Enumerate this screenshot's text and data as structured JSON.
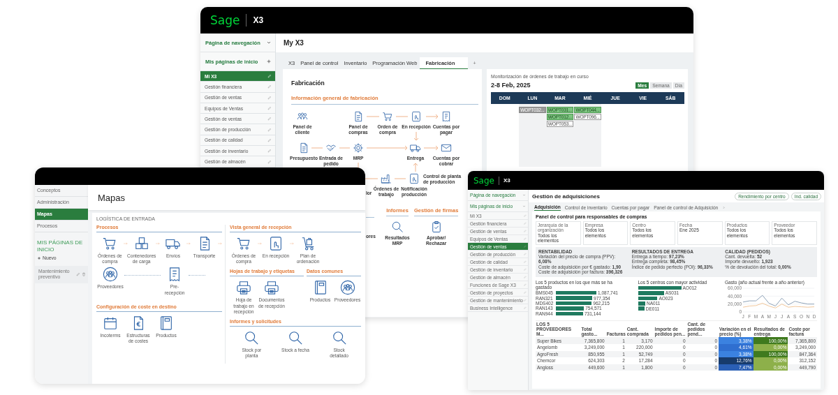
{
  "back_window": {
    "brand": "Sage",
    "product": "X3",
    "nav": {
      "title": "Página de navegación",
      "home_title": "Mis páginas de inicio",
      "items": [
        {
          "label": "Mi X3",
          "selected": true
        },
        {
          "label": "Gestión financiera",
          "selected": false
        },
        {
          "label": "Gestión de ventas",
          "selected": false
        },
        {
          "label": "Equipos de Ventas",
          "selected": false
        },
        {
          "label": "Gestión de ventas",
          "selected": false
        },
        {
          "label": "Gestión de producción",
          "selected": false
        },
        {
          "label": "Gestión de calidad",
          "selected": false
        },
        {
          "label": "Gestión de inventario",
          "selected": false
        },
        {
          "label": "Gestión de almacén",
          "selected": false
        }
      ]
    },
    "page_title": "My X3",
    "tabs": [
      {
        "label": "X3",
        "selected": false
      },
      {
        "label": "Panel de control",
        "selected": false
      },
      {
        "label": "Inventario",
        "selected": false
      },
      {
        "label": "Programación Web",
        "selected": false
      },
      {
        "label": "Fabricación",
        "selected": true
      }
    ],
    "add_tab": "+",
    "manufacturing_panel": {
      "title": "Fabricación",
      "section": "Información general de fabricación",
      "nodes": [
        {
          "label": "Panel de cliente"
        },
        {
          "label": "Panel de compras"
        },
        {
          "label": "Orden de compra"
        },
        {
          "label": "En recepción"
        },
        {
          "label": "Cuentas por pagar"
        },
        {
          "label": "Presupuesto"
        },
        {
          "label": "Entrada de pedido"
        },
        {
          "label": "MRP"
        },
        {
          "label": "Entrega"
        },
        {
          "label": "Cuentas por cobrar"
        },
        {
          "label": "Órdenes de trabajo"
        },
        {
          "label": "Notificación producción"
        },
        {
          "label": "Control de planta de producción"
        }
      ],
      "cut_labels": [
        "lor",
        "ores"
      ],
      "sections": [
        {
          "title": "Informes",
          "items": [
            {
              "label": "Resultados MRP"
            }
          ]
        },
        {
          "title": "Gestión de firmas",
          "items": [
            {
              "label": "Aprobar/ Rechazar"
            }
          ]
        }
      ]
    },
    "calendar": {
      "title": "Monitorización de órdenes de trabajo en curso",
      "range": "2-8 Feb, 2025",
      "views": [
        {
          "label": "Mes",
          "selected": true
        },
        {
          "label": "Semana",
          "selected": false
        },
        {
          "label": "Día",
          "selected": false
        }
      ],
      "days": [
        {
          "label": "DOM"
        },
        {
          "label": "LUN",
          "events": [
            {
              "label": "WOPT032...",
              "kind": "held"
            }
          ]
        },
        {
          "label": "MAR",
          "events": [
            {
              "label": "WOPT031...",
              "kind": "released"
            },
            {
              "label": "WOPT012...",
              "kind": "released"
            },
            {
              "label": "WOPT053...",
              "kind": "planned"
            }
          ]
        },
        {
          "label": "MIÉ",
          "events": [
            {
              "label": "WOPT044...",
              "kind": "released"
            },
            {
              "label": "WOPT096...",
              "kind": "planned"
            }
          ]
        },
        {
          "label": "JUE"
        },
        {
          "label": "VIE"
        },
        {
          "label": "SÁB"
        }
      ]
    }
  },
  "left_window": {
    "sidebar": {
      "items": [
        {
          "label": "Conceptos",
          "selected": false
        },
        {
          "label": "Administración",
          "selected": false
        },
        {
          "label": "Mapas",
          "selected": true
        },
        {
          "label": "Procesos",
          "selected": false
        }
      ],
      "home_title": "MIS PÁGINAS DE INICIO",
      "new_label": "Nuevo",
      "pages": [
        {
          "label": "Mantenimiento preventivo"
        }
      ]
    },
    "page_title": "Mapas",
    "map_title": "LOGÍSTICA DE ENTRADA",
    "sections": [
      {
        "title": "Procesos",
        "nodes": [
          {
            "label": "Órdenes de compra"
          },
          {
            "label": "Contenedores de carga"
          },
          {
            "label": "Envíos"
          },
          {
            "label": "Transporte"
          },
          {
            "label": "Proveedores"
          },
          {
            "label": "Pre-recepción"
          }
        ]
      },
      {
        "title": "Configuración de coste en destino",
        "nodes": [
          {
            "label": "Incoterms"
          },
          {
            "label": "Estructuras de costes"
          },
          {
            "label": "Productos"
          }
        ]
      },
      {
        "title": "Vista general de recepción",
        "nodes": [
          {
            "label": "Órdenes de compra"
          },
          {
            "label": "En recepción"
          },
          {
            "label": "Plan de ordenación"
          }
        ]
      },
      {
        "title": "Hojas de trabajo y etiquetas",
        "nodes": [
          {
            "label": "Hoja de trabajo en recepción"
          },
          {
            "label": "Documentos de recepción"
          }
        ]
      },
      {
        "title": "Datos comunes",
        "nodes": [
          {
            "label": "Productos"
          },
          {
            "label": "Proveedores"
          }
        ]
      },
      {
        "title": "Informes y solicitudes",
        "nodes": [
          {
            "label": "Stock por planta"
          },
          {
            "label": "Stock a fecha"
          },
          {
            "label": "Stock detallado"
          }
        ]
      }
    ]
  },
  "right_window": {
    "brand": "Sage",
    "product": "X3",
    "nav": {
      "title": "Página de navegación",
      "home_title": "Mis páginas de inicio",
      "items": [
        {
          "label": "Mi X3",
          "selected": false
        },
        {
          "label": "Gestión financiera",
          "selected": false
        },
        {
          "label": "Gestión de ventas",
          "selected": false
        },
        {
          "label": "Equipos de Ventas",
          "selected": false
        },
        {
          "label": "Gestión de ventas",
          "selected": true
        },
        {
          "label": "Gestión de producción",
          "selected": false
        },
        {
          "label": "Gestión de calidad",
          "selected": false
        },
        {
          "label": "Gestión de inventario",
          "selected": false
        },
        {
          "label": "Gestión de almacén",
          "selected": false
        },
        {
          "label": "Funciones de Sage X3",
          "selected": false
        },
        {
          "label": "Gestión de proyectos",
          "selected": false
        },
        {
          "label": "Gestión de mantenimiento",
          "selected": false
        },
        {
          "label": "Business Intelligence",
          "selected": false
        }
      ]
    },
    "page_title": "Gestión de adquisiciones",
    "header_buttons": [
      "Rendimiento por centro",
      "Ind. calidad"
    ],
    "tabs": [
      {
        "label": "Adquisición",
        "selected": true
      },
      {
        "label": "Control de inventario",
        "selected": false
      },
      {
        "label": "Cuentas por pagar",
        "selected": false
      },
      {
        "label": "Panel de control de Adquisición",
        "selected": false
      }
    ],
    "dashboard_title": "Panel de control para responsables de compras",
    "filters": [
      {
        "label": "Jerarquía de la organización",
        "value": "Todos los elementos"
      },
      {
        "label": "Empresa",
        "value": "Todos los elementos"
      },
      {
        "label": "Centro",
        "value": "Todos los elementos"
      },
      {
        "label": "Fecha",
        "value": "Ene 2025"
      },
      {
        "label": "Productos",
        "value": "Todos los elementos"
      },
      {
        "label": "Proveedor",
        "value": "Todos los elementos"
      }
    ],
    "kpis": [
      {
        "title": "RENTABILIDAD",
        "lines": [
          "Variación del precio de compra (PPV): **6,08%**",
          "Coste de adquisición por € gastado: **1,90**",
          "Coste de adquisición por factura: **396,326**"
        ]
      },
      {
        "title": "RESULTADOS DE ENTREGA",
        "lines": [
          "Entrega a tiempo: **97,23%**",
          "Entrega completa: **98,45%**",
          "Índice de pedido perfecto (POI): **96,33%**"
        ]
      },
      {
        "title": "CALIDAD (PEDIDOS)",
        "lines": [
          "Cant. devuelta: **52**",
          "Importe devuelto: **1,923**",
          "% de devolución del total: **0,00%**"
        ]
      }
    ],
    "top_products": {
      "chart_data": {
        "type": "bar",
        "title": "Los 5 productos en los que más se ha gastado",
        "orientation": "horizontal",
        "categories": [
          "BMS045",
          "RAN321",
          "MDS402",
          "RAN143",
          "RAN944"
        ],
        "values": [
          1087741,
          977354,
          962215,
          754571,
          731144
        ],
        "value_labels": [
          "1,087,741",
          "977,354",
          "962,215",
          "754,571",
          "731,144"
        ]
      }
    },
    "top_centers": {
      "title": "Los 5 centros con mayor actividad",
      "labels": [
        "AO012",
        "AS031",
        "AO023",
        "NA011",
        "DE011"
      ]
    },
    "spend_trend": {
      "chart_data": {
        "type": "line",
        "title": "Gasto (año actual frente a año anterior)",
        "x": [
          "J",
          "F",
          "M",
          "A",
          "M",
          "J",
          "J",
          "A",
          "S",
          "O",
          "N",
          "D"
        ],
        "series": [
          {
            "color": "#8fa3b8",
            "values": [
              25000,
              28000,
              28000,
              42000,
              22000,
              15000,
              35000,
              18000,
              27000,
              23000,
              20000,
              20000
            ]
          },
          {
            "color": "#f2c79a",
            "values": [
              12000,
              15000,
              16000,
              22000,
              15000,
              10000,
              20000,
              12000,
              14000,
              13000,
              12000,
              13000
            ]
          }
        ],
        "ylim": [
          0,
          60000
        ],
        "yticks": [
          {
            "value": 0,
            "label": "0"
          },
          {
            "value": 20000,
            "label": "20,000"
          },
          {
            "value": 40000,
            "label": "40,000"
          },
          {
            "value": 60000,
            "label": "60,000"
          }
        ]
      }
    },
    "table": {
      "columns": [
        "LOS 5 PROVEEDORES M...",
        "Total gasto...",
        "Facturas",
        "Cant. comprada",
        "Importe de pedidos pen...",
        "Cant. de pedidos pend...",
        "Variación en el precio (%)",
        "Resultados de entrega",
        "Coste por factura"
      ],
      "rows": [
        {
          "cells": [
            "Super Bikes",
            "7,365,800",
            "1",
            "3,170",
            "0",
            "0"
          ],
          "variation": {
            "text": "3,38%",
            "color": "#3b82e0"
          },
          "delivery": {
            "text": "100,00%",
            "color": "#3f7a1e"
          },
          "cost": "7,365,800"
        },
        {
          "cells": [
            "Angelomb",
            "3,249,000",
            "1",
            "220,000",
            "0",
            "0"
          ],
          "variation": {
            "text": "4,61%",
            "color": "#2f6fd0"
          },
          "delivery": {
            "text": "0,00%",
            "color": "#8db04a"
          },
          "cost": "3,249,000"
        },
        {
          "cells": [
            "AgroFresh",
            "850,955",
            "1",
            "52,749",
            "0",
            "0"
          ],
          "variation": {
            "text": "3,38%",
            "color": "#3b82e0"
          },
          "delivery": {
            "text": "100,00%",
            "color": "#3f7a1e"
          },
          "cost": "847,364"
        },
        {
          "cells": [
            "Chemcor",
            "624,303",
            "2",
            "17,284",
            "0",
            "0"
          ],
          "variation": {
            "text": "12,76%",
            "color": "#173b6c"
          },
          "delivery": {
            "text": "0,00%",
            "color": "#8db04a"
          },
          "cost": "312,152"
        },
        {
          "cells": [
            "Angloss",
            "449,600",
            "1",
            "1,800",
            "0",
            "0"
          ],
          "variation": {
            "text": "7,47%",
            "color": "#2a5fb5"
          },
          "delivery": {
            "text": "0,00%",
            "color": "#8db04a"
          },
          "cost": "449,790"
        }
      ]
    }
  }
}
